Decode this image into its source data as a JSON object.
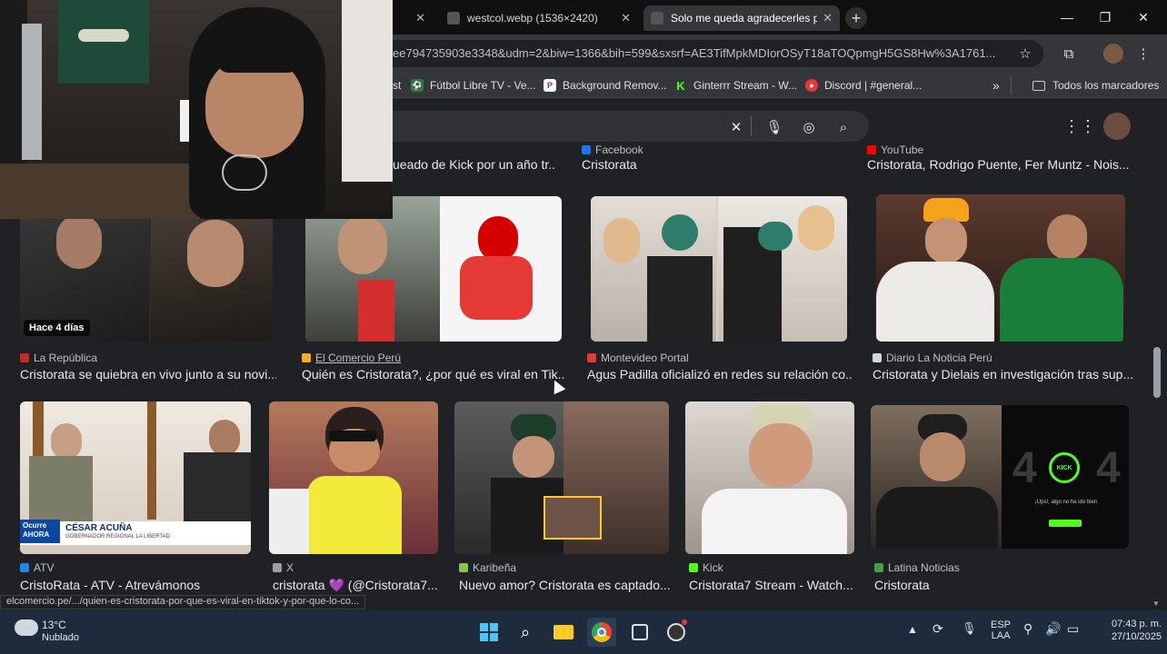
{
  "browser": {
    "tabs": [
      {
        "label": "(",
        "active": false
      },
      {
        "label": "westcol.webp (1536×2420)",
        "active": false
      },
      {
        "label": "Solo me queda agradecerles po",
        "active": true
      }
    ],
    "url": "ee794735903e3348&udm=2&biw=1366&bih=599&sxsrf=AE3TifMpkMDIorOSyT18aTOQpmgH5GS8Hw%3A1761...",
    "bookmarks": [
      {
        "label": "st",
        "icon": "partial-favicon"
      },
      {
        "label": "Fútbol Libre TV - Ve...",
        "icon": "futbol-libre-icon"
      },
      {
        "label": "Background Remov...",
        "icon": "background-remover-icon"
      },
      {
        "label": "Ginterrr Stream - W...",
        "icon": "kick-icon"
      },
      {
        "label": "Discord | #general...",
        "icon": "discord-icon"
      }
    ],
    "bookmarks_more": "»",
    "all_bookmarks": "Todos los marcadores"
  },
  "top_row": [
    {
      "source": "",
      "title": "ueado de Kick por un año tr..."
    },
    {
      "source": "Facebook",
      "title": "Cristorata"
    },
    {
      "source": "YouTube",
      "title": "Cristorata, Rodrigo Puente, Fer Muntz - Nois..."
    }
  ],
  "results_row1": [
    {
      "source": "La República",
      "title": "Cristorata se quiebra en vivo junto a su novi...",
      "badge": "Hace 4 días",
      "fav_color": "#c62828"
    },
    {
      "source": "El Comercio Perú",
      "title": "Quién es Cristorata?, ¿por qué es viral en Tik...",
      "fav_color": "#f9a825"
    },
    {
      "source": "Montevideo Portal",
      "title": "Agus Padilla oficializó en redes su relación co...",
      "fav_color": "#e53935"
    },
    {
      "source": "Diario La Noticia Perú",
      "title": "Cristorata y Dielais en investigación tras sup...",
      "fav_color": "#cfd8dc"
    }
  ],
  "results_row2": [
    {
      "source": "ATV",
      "title": "CristoRata - ATV - Atrevámonos",
      "fav_color": "#1e88e5",
      "overlay": {
        "tag": "Ocurre AHORA",
        "name": "CÉSAR ACUÑA",
        "sub": "GOBERNADOR REGIONAL LA LIBERTAD"
      }
    },
    {
      "source": "X",
      "title": "cristorata 💜 (@Cristorata7...",
      "fav_color": "#9e9e9e"
    },
    {
      "source": "Karibeña",
      "title": "Nuevo amor? Cristorata es captado...",
      "fav_color": "#8bc34a"
    },
    {
      "source": "Kick",
      "title": "Cristorata7 Stream - Watch...",
      "fav_color": "#53fc18"
    },
    {
      "source": "Latina Noticias",
      "title": "Cristorata",
      "fav_color": "#43a047",
      "kick404": {
        "digits": "4",
        "logo": "KICK",
        "msg": "¡Ups!, algo no ha ido bien"
      }
    }
  ],
  "status_url": "elcomercio.pe/.../quien-es-cristorata-por-que-es-viral-en-tiktok-y-por-que-lo-co...",
  "taskbar": {
    "weather_temp": "13°C",
    "weather_desc": "Nublado",
    "lang1": "ESP",
    "lang2": "LAA",
    "time": "07:43 p. m.",
    "date": "27/10/2025"
  }
}
